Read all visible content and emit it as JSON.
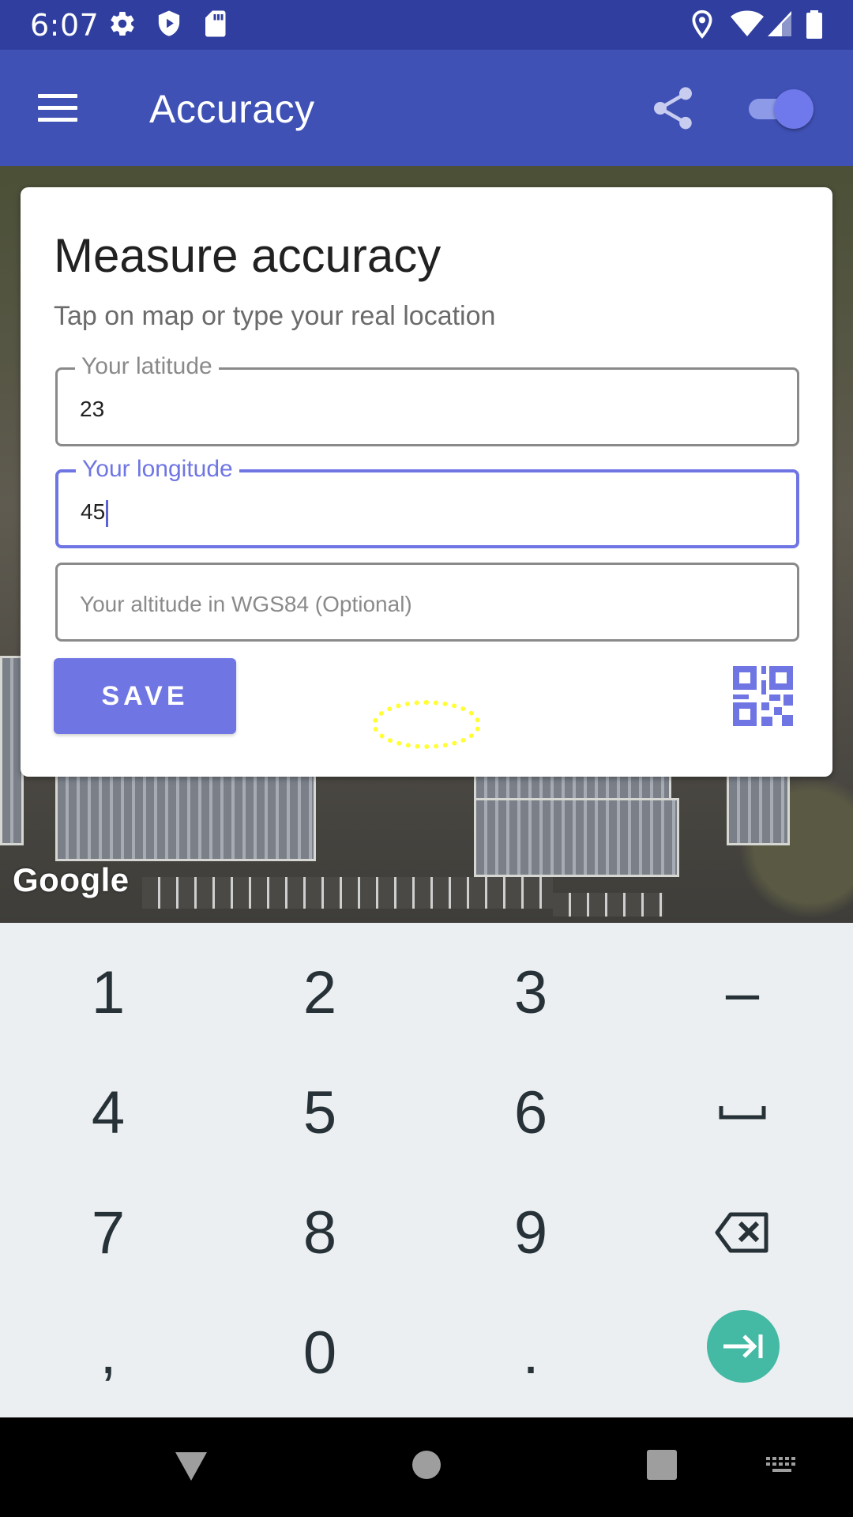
{
  "status_bar": {
    "time": "6:07",
    "icons_left": [
      "settings-icon",
      "shield-icon",
      "sd-card-icon"
    ],
    "icons_right": [
      "location-pin-icon",
      "wifi-icon",
      "signal-icon",
      "battery-icon"
    ]
  },
  "app_bar": {
    "title": "Accuracy",
    "menu_icon": "hamburger-menu-icon",
    "share_icon": "share-icon",
    "toggle_on": true
  },
  "card": {
    "title": "Measure accuracy",
    "subtitle": "Tap on map or type your real location",
    "latitude": {
      "label": "Your latitude",
      "value": "23"
    },
    "longitude": {
      "label": "Your longitude",
      "value": "45"
    },
    "altitude": {
      "placeholder": "Your altitude in WGS84 (Optional)"
    },
    "save_label": "SAVE",
    "qr_icon": "qr-code-icon"
  },
  "map": {
    "attribution": "Google"
  },
  "keyboard": {
    "rows": [
      [
        "1",
        "2",
        "3",
        "–"
      ],
      [
        "4",
        "5",
        "6",
        "space"
      ],
      [
        "7",
        "8",
        "9",
        "backspace"
      ],
      [
        ",",
        "0",
        ".",
        "next"
      ]
    ]
  },
  "nav_bar": {
    "buttons": [
      "back-icon",
      "home-icon",
      "recents-icon",
      "keyboard-switch-icon"
    ]
  },
  "colors": {
    "status_bar": "#303f9f",
    "app_bar": "#3f51b5",
    "accent": "#6f75e3",
    "enter_key": "#44b9a4",
    "keyboard_bg": "#eceff1",
    "tap_indicator": "#ffff33"
  }
}
